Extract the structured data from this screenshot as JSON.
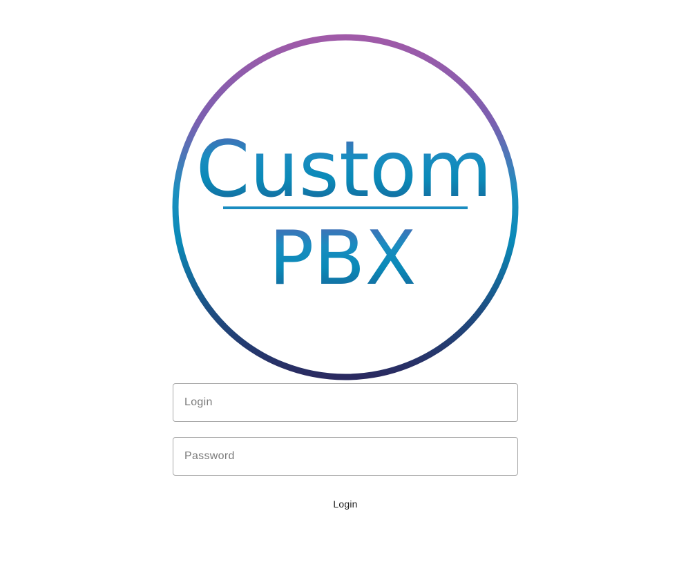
{
  "logo": {
    "line1": "Custom",
    "line2": "PBX",
    "colors": {
      "ring_top": "#a05aa8",
      "ring_mid": "#0e8bb8",
      "ring_bottom": "#2a2a60",
      "text_top": "#4a6fb5",
      "text_mid": "#0a8ab8",
      "text_bottom": "#1a5a90"
    }
  },
  "form": {
    "login_placeholder": "Login",
    "login_value": "",
    "password_placeholder": "Password",
    "password_value": "",
    "submit_label": "Login"
  }
}
